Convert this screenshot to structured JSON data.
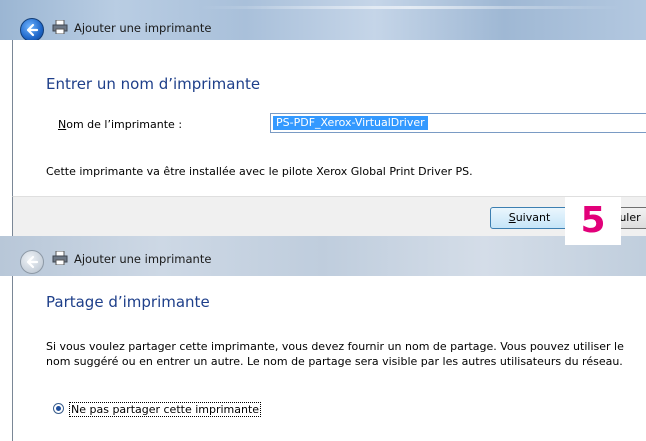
{
  "window1": {
    "title": "Ajouter une imprimante",
    "heading": "Entrer un nom d’imprimante",
    "name_label_accel": "N",
    "name_label_rest": "om de l’imprimante :",
    "name_value": "PS-PDF_Xerox-VirtualDriver",
    "driver_text": "Cette imprimante va être installée avec le pilote Xerox Global Print Driver PS.",
    "next_accel": "S",
    "next_rest": "uivant",
    "cancel_label": "nuler",
    "icons": {
      "back": "back-arrow-icon",
      "printer": "printer-icon"
    }
  },
  "step_badge": "5",
  "window2": {
    "title": "Ajouter une imprimante",
    "heading": "Partage d’imprimante",
    "description": "Si vous voulez partager cette imprimante, vous devez fournir un nom de partage. Vous pouvez utiliser le nom suggéré ou en entrer un autre. Le nom de partage sera visible par les autres utilisateurs du réseau.",
    "radio_no_share": "Ne pas partager cette imprimante"
  },
  "colors": {
    "heading": "#1e3f8a",
    "badge": "#e2007a",
    "selection": "#3399ff"
  }
}
